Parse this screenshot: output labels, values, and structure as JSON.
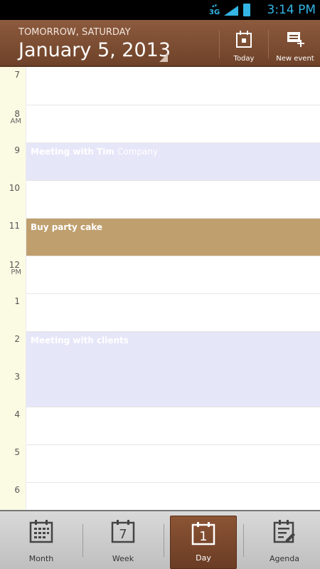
{
  "status_bar": {
    "network": "3G",
    "time": "3:14 PM",
    "accent": "#33b5e5"
  },
  "header": {
    "subtitle": "TOMORROW, SATURDAY",
    "date": "January 5, 2013",
    "today_label": "Today",
    "new_event_label": "New event"
  },
  "hours": [
    {
      "num": "7",
      "ampm": ""
    },
    {
      "num": "8",
      "ampm": "AM"
    },
    {
      "num": "9",
      "ampm": ""
    },
    {
      "num": "10",
      "ampm": ""
    },
    {
      "num": "11",
      "ampm": ""
    },
    {
      "num": "12",
      "ampm": "PM"
    },
    {
      "num": "1",
      "ampm": ""
    },
    {
      "num": "2",
      "ampm": ""
    },
    {
      "num": "3",
      "ampm": ""
    },
    {
      "num": "4",
      "ampm": ""
    },
    {
      "num": "5",
      "ampm": ""
    },
    {
      "num": "6",
      "ampm": ""
    }
  ],
  "events": [
    {
      "title": "Meeting with Tim",
      "location": "Company",
      "color": "#e6e6f9",
      "text_color": "#ffffff",
      "start": "9",
      "end": "10"
    },
    {
      "title": "Buy party cake",
      "location": "",
      "color": "#bf9f6e",
      "text_color": "#ffffff",
      "start": "11",
      "end": "12"
    },
    {
      "title": "Meeting with clients",
      "location": "",
      "color": "#e6e6f9",
      "text_color": "#ffffff",
      "start": "2",
      "end": "4"
    }
  ],
  "tabs": {
    "month": "Month",
    "week": "Week",
    "week_num": "7",
    "day": "Day",
    "day_num": "1",
    "agenda": "Agenda",
    "active": "Day"
  }
}
